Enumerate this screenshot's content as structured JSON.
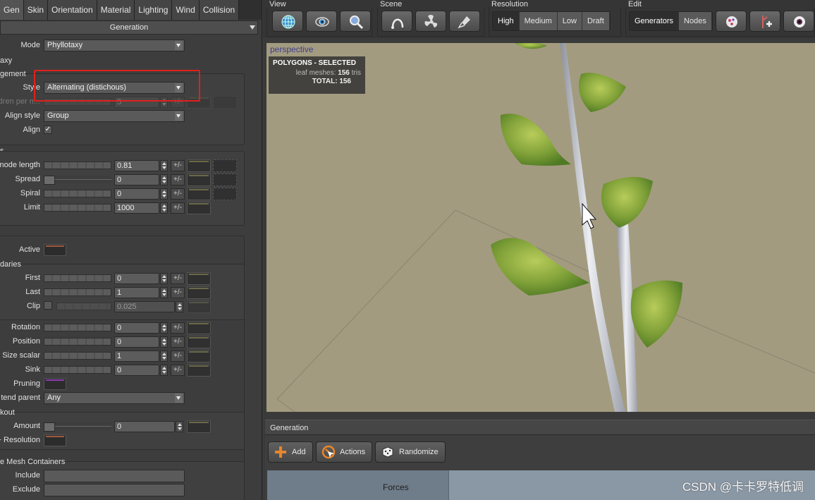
{
  "tabs": [
    "Gen",
    "Skin",
    "Orientation",
    "Material",
    "Lighting",
    "Wind",
    "Collision"
  ],
  "active_tab_index": 0,
  "panel": {
    "header": "Generation",
    "mode_label": "Mode",
    "mode_value": "Phyllotaxy",
    "phyllotaxy_section": "axy",
    "arrangement_section": "gement",
    "style_label": "Style",
    "style_value": "Alternating (distichous)",
    "children_label": "dren per n...",
    "children_value": "5",
    "align_style_label": "Align style",
    "align_style_value": "Group",
    "align_label": "Align",
    "align_checked": "✓",
    "spacing_section": "s",
    "node_length_label": "node length",
    "node_length_value": "0.81",
    "spread_label": "Spread",
    "spread_value": "0",
    "spiral_label": "Spiral",
    "spiral_value": "0",
    "limit_label": "Limit",
    "limit_value": "1000",
    "active_label": "Active",
    "boundaries_section": "daries",
    "first_label": "First",
    "first_value": "0",
    "last_label": "Last",
    "last_value": "1",
    "clip_label": "Clip",
    "clip_value": "0.025",
    "rotation_label": "Rotation",
    "rotation_value": "0",
    "position_label": "Position",
    "position_value": "0",
    "size_scalar_label": "Size scalar",
    "size_scalar_value": "1",
    "sink_label": "Sink",
    "sink_value": "0",
    "pruning_label": "Pruning",
    "extend_parent_label": "tend parent",
    "extend_parent_value": "Any",
    "knockout_section": "kout",
    "amount_label": "Amount",
    "amount_value": "0",
    "resolution_label": "+ Resolution",
    "mesh_containers_section": "e Mesh Containers",
    "include_label": "Include",
    "exclude_label": "Exclude",
    "plusminus": "+/-"
  },
  "toolbar": {
    "view_label": "View",
    "scene_label": "Scene",
    "resolution_label": "Resolution",
    "resolution_options": [
      "High",
      "Medium",
      "Low",
      "Draft"
    ],
    "resolution_selected": "High",
    "edit_label": "Edit",
    "edit_options": [
      "Generators",
      "Nodes"
    ],
    "edit_selected": "Generators"
  },
  "viewport": {
    "camera": "perspective",
    "info_title": "POLYGONS - SELECTED",
    "leaf_meshes_label": "leaf meshes:",
    "leaf_meshes_value": "156",
    "leaf_meshes_unit": "tris",
    "total_label": "TOTAL:",
    "total_value": "156"
  },
  "generation_panel": {
    "title": "Generation",
    "add_label": "Add",
    "actions_label": "Actions",
    "randomize_label": "Randomize",
    "forces_label": "Forces"
  },
  "watermark": "CSDN @卡卡罗特低调",
  "colors": {
    "highlight_box": "#e0201c",
    "viewport_bg": "#a39b80",
    "camera_label": "#3d3d8a"
  }
}
